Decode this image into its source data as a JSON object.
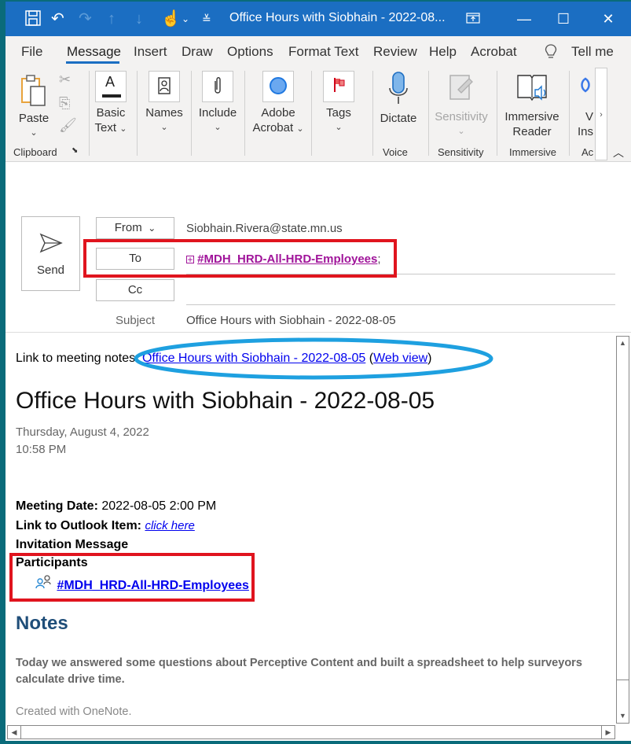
{
  "window": {
    "title": "Office Hours with Siobhain - 2022-08...",
    "quick_access": [
      "save-icon",
      "undo-icon",
      "redo-icon",
      "up-arrow-icon",
      "down-arrow-icon",
      "touch-mode-icon",
      "dropdown-icon",
      "customize-icon"
    ],
    "controls": {
      "restore_ribbon": "ribbon-display-icon",
      "minimize": "—",
      "maximize": "☐",
      "close": "✕"
    }
  },
  "menu": {
    "items": [
      "File",
      "Message",
      "Insert",
      "Draw",
      "Options",
      "Format Text",
      "Review",
      "Help",
      "Acrobat"
    ],
    "active": "Message",
    "tell_me": "Tell me"
  },
  "ribbon": {
    "paste": "Paste",
    "basic_text": [
      "Basic",
      "Text"
    ],
    "names": "Names",
    "include": "Include",
    "adobe_acrobat": [
      "Adobe",
      "Acrobat"
    ],
    "tags": "Tags",
    "dictate": "Dictate",
    "sensitivity": "Sensitivity",
    "immersive_reader": [
      "Immersive",
      "Reader"
    ],
    "viva_insights": [
      "V",
      "Ins"
    ],
    "groups": {
      "clipboard": "Clipboard",
      "voice": "Voice",
      "sensitivity": "Sensitivity",
      "immersive": "Immersive",
      "addins": "Ac"
    }
  },
  "compose": {
    "send": "Send",
    "from_label": "From",
    "from_value": "Siobhain.Rivera@state.mn.us",
    "to_label": "To",
    "to_value": "#MDH_HRD-All-HRD-Employees",
    "to_separator": ";",
    "cc_label": "Cc",
    "cc_value": "",
    "subject_label": "Subject",
    "subject_value": "Office Hours with Siobhain - 2022-08-05"
  },
  "body": {
    "link_prefix": "Link to meeting notes: ",
    "notes_link": "Office Hours with Siobhain - 2022-08-05",
    "web_view_open": " (",
    "web_view_link": "Web view",
    "web_view_close": ")",
    "heading": "Office Hours with Siobhain - 2022-08-05",
    "date": "Thursday, August 4, 2022",
    "time": "10:58 PM",
    "meeting_date_label": "Meeting Date:",
    "meeting_date_value": " 2022-08-05 2:00 PM",
    "outlook_item_label": "Link to Outlook Item:",
    "outlook_item_link": "click here",
    "invitation_label": "Invitation Message",
    "participants_label": "Participants",
    "participant": "#MDH_HRD-All-HRD-Employees",
    "notes_heading": "Notes",
    "notes_text": "Today we answered some questions about Perceptive Content and built a spreadsheet to help surveyors calculate drive time.",
    "footer": "Created with OneNote."
  },
  "colors": {
    "titlebar": "#1b6ec2",
    "highlight_red": "#e0141e",
    "highlight_blue": "#1ea0e0",
    "recipient_purple": "#a0149a",
    "notes_heading": "#1f4e79"
  }
}
